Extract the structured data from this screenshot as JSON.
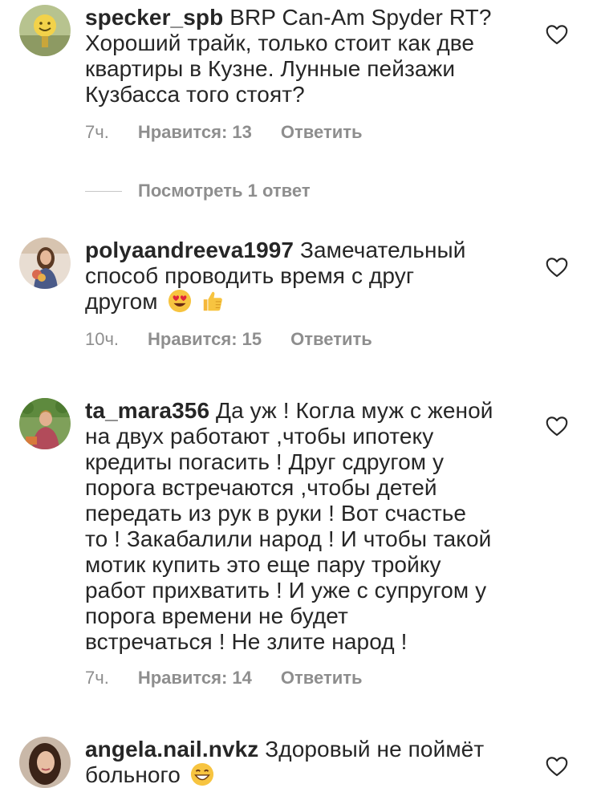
{
  "comments": [
    {
      "username": "specker_spb",
      "lines": [
        " BRP Can-Am Spyder RT?",
        "Хороший трайк, только стоит как две",
        "квартиры в Кузне. Лунные пейзажи",
        "Кузбасса того стоят?"
      ],
      "time": "7ч.",
      "likes": "Нравится: 13",
      "reply": "Ответить",
      "view_replies": "Посмотреть 1 ответ"
    },
    {
      "username": "polyaandreeva1997",
      "lines": [
        " Замечательный",
        "способ проводить время с друг",
        "другом"
      ],
      "emojis": [
        "heart-eyes-emoji",
        "thumbs-up-emoji"
      ],
      "time": "10ч.",
      "likes": "Нравится: 15",
      "reply": "Ответить"
    },
    {
      "username": "ta_mara356",
      "lines": [
        " Да уж ! Когла муж с женой",
        "на двух работают ,чтобы ипотеку",
        "кредиты погасить ! Друг сдругом у",
        "порога встречаются ,чтобы детей",
        "передать из рук в руки ! Вот счастье",
        "то ! Закабалили народ ! И чтобы такой",
        "мотик купить это  еще пару тройку",
        "работ прихватить ! И уже с супругом у",
        "порога времени не будет",
        "встречаться ! Не злите народ !"
      ],
      "time": "7ч.",
      "likes": "Нравится: 14",
      "reply": "Ответить"
    },
    {
      "username": "angela.nail.nvkz",
      "lines": [
        " Здоровый не поймёт",
        "больного"
      ],
      "emojis": [
        "grinning-emoji"
      ]
    }
  ],
  "colors": {
    "text": "#262626",
    "secondary": "#8e8e8e",
    "divider": "#c7c7c7"
  },
  "icons": {
    "like": "heart-outline-icon"
  }
}
